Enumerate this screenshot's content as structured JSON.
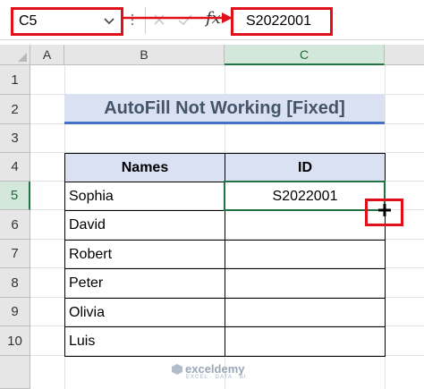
{
  "formula_bar": {
    "name_box_value": "C5",
    "formula_value": "S2022001",
    "fx_symbol": "fx"
  },
  "columns": [
    "A",
    "B",
    "C"
  ],
  "rows": [
    "1",
    "2",
    "3",
    "4",
    "5",
    "6",
    "7",
    "8",
    "9",
    "10"
  ],
  "active_column": "C",
  "active_row": "5",
  "title": "AutoFill Not Working [Fixed]",
  "table": {
    "headers": [
      "Names",
      "ID"
    ],
    "rows": [
      {
        "name": "Sophia",
        "id": "S2022001"
      },
      {
        "name": "David",
        "id": ""
      },
      {
        "name": "Robert",
        "id": ""
      },
      {
        "name": "Peter",
        "id": ""
      },
      {
        "name": "Olivia",
        "id": ""
      },
      {
        "name": "Luis",
        "id": ""
      }
    ]
  },
  "watermark": {
    "brand": "exceldemy",
    "tagline": "EXCEL · DATA · BI"
  },
  "colors": {
    "highlight_red": "#e0101a",
    "excel_green": "#217346",
    "header_fill": "#d9e1f2",
    "title_underline": "#4472c4"
  }
}
